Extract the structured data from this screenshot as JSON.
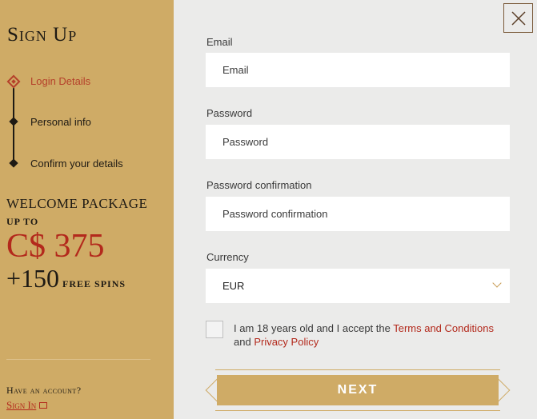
{
  "sidebar": {
    "title": "Sign Up",
    "steps": [
      {
        "label": "Login Details"
      },
      {
        "label": "Personal info"
      },
      {
        "label": "Confirm your details"
      }
    ],
    "welcome": {
      "heading": "WELCOME PACKAGE",
      "upto": "UP TO",
      "amount": "C$ 375",
      "spins_count": "+150",
      "spins_label": "FREE SPINS"
    },
    "account": {
      "question": "Have an account?",
      "signin": "Sign In"
    }
  },
  "form": {
    "email": {
      "label": "Email",
      "placeholder": "Email"
    },
    "password": {
      "label": "Password",
      "placeholder": "Password"
    },
    "password_confirmation": {
      "label": "Password confirmation",
      "placeholder": "Password confirmation"
    },
    "currency": {
      "label": "Currency",
      "value": "EUR"
    },
    "terms": {
      "prefix": "I am 18 years old and I accept the ",
      "terms_link": "Terms and Conditions",
      "middle": " and ",
      "privacy_link": "Privacy Policy"
    },
    "next_label": "NEXT"
  },
  "colors": {
    "accent": "#cfab66",
    "link": "#b3291c"
  },
  "icons": {
    "close": "close-icon",
    "chevron": "chevron-down-icon"
  }
}
